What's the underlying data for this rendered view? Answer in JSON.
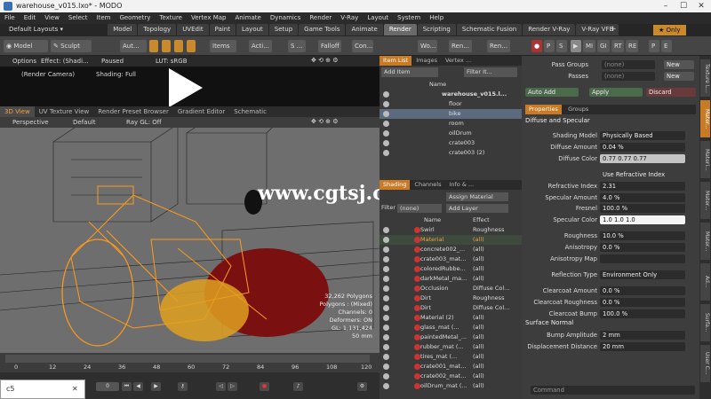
{
  "window": {
    "title": "warehouse_v015.lxo* - MODO",
    "min": "–",
    "max": "☐",
    "close": "✕"
  },
  "menu": [
    "File",
    "Edit",
    "View",
    "Select",
    "Item",
    "Geometry",
    "Texture",
    "Vertex Map",
    "Animate",
    "Dynamics",
    "Render",
    "V-Ray",
    "Layout",
    "System",
    "Help"
  ],
  "layout": {
    "default": "Default Layouts ▾",
    "tabs": [
      "Model",
      "Topology",
      "UVEdit",
      "Paint",
      "Layout",
      "Setup",
      "Game Tools",
      "Animate",
      "Render",
      "Scripting",
      "Schematic Fusion",
      "Render V-Ray",
      "V-Ray VFB"
    ],
    "active_tab": "Render",
    "plus": "+",
    "only": "★ Only"
  },
  "toolbar": {
    "model": "Model",
    "sculpt": "Sculpt",
    "aut": "Aut...",
    "items": "Items",
    "acti": "Acti...",
    "s": "S ...",
    "falloff": "Falloff",
    "con": "Con...",
    "wo": "Wo...",
    "ren1": "Ren...",
    "ren2": "Ren...",
    "btns": [
      "P",
      "S"
    ],
    "render_btns": [
      "MI",
      "GI",
      "RT",
      "RE",
      "P",
      "E"
    ]
  },
  "render_view": {
    "options": "Options",
    "effect": "Effect: (Shadi...",
    "paused": "Paused",
    "lut": "LUT: sRGB",
    "camera": "(Render Camera)",
    "shading": "Shading: Full"
  },
  "viewport": {
    "tabs": [
      "3D View",
      "UV Texture View",
      "Render Preset Browser",
      "Gradient Editor",
      "Schematic"
    ],
    "active": "3D View",
    "perspective": "Perspective",
    "default": "Default",
    "raygl": "Ray GL: Off",
    "stats": [
      "32,262 Polygons",
      "Polygons : (Mixed)",
      "Channels: 0",
      "Deformers: ON",
      "GL: 1,131,424",
      "50 mm"
    ]
  },
  "timeline": {
    "ticks": [
      "0",
      "12",
      "24",
      "36",
      "48",
      "60",
      "72",
      "84",
      "96",
      "108",
      "120"
    ],
    "sub": [
      "0",
      "",
      "",
      "",
      "",
      "",
      "",
      "",
      "",
      "",
      "120"
    ],
    "frame": "0"
  },
  "taskbar": {
    "label": "c5",
    "close": "✕"
  },
  "itemlist": {
    "tabs": [
      "Item List",
      "Images",
      "Vertex ..."
    ],
    "add_item": "Add Item",
    "filter": "Filter It...",
    "header": "Name",
    "items": [
      {
        "name": "warehouse_v015.l...",
        "indent": 0
      },
      {
        "name": "floor",
        "indent": 1
      },
      {
        "name": "bike",
        "indent": 1,
        "selected": true
      },
      {
        "name": "room",
        "indent": 1
      },
      {
        "name": "oilDrum",
        "indent": 1
      },
      {
        "name": "crate003",
        "indent": 1
      },
      {
        "name": "crate003 (2)",
        "indent": 1
      }
    ]
  },
  "shading": {
    "tabs": [
      "Shading",
      "Channels",
      "Info & ..."
    ],
    "assign": "Assign Material",
    "filter_label": "Filter",
    "filter": "(none)",
    "add_layer": "Add Layer",
    "col_name": "Name",
    "col_effect": "Effect",
    "rows": [
      {
        "name": "Swirl",
        "effect": "Roughness"
      },
      {
        "name": "Material",
        "effect": "(all)",
        "hl": true
      },
      {
        "name": "concrete002_...",
        "effect": "(all)"
      },
      {
        "name": "crate003_mat...",
        "effect": "(all)"
      },
      {
        "name": "coloredRubbe...",
        "effect": "(all)"
      },
      {
        "name": "darkMetal_ma...",
        "effect": "(all)"
      },
      {
        "name": "Occlusion",
        "effect": "Diffuse Col..."
      },
      {
        "name": "Dirt",
        "effect": "Roughness"
      },
      {
        "name": "Dirt",
        "effect": "Diffuse Col..."
      },
      {
        "name": "Material (2)",
        "effect": "(all)"
      },
      {
        "name": "glass_mat (...",
        "effect": "(all)"
      },
      {
        "name": "paintedMetal_...",
        "effect": "(all)"
      },
      {
        "name": "rubber_mat (...",
        "effect": "(all)"
      },
      {
        "name": "tires_mat (...",
        "effect": "(all)"
      },
      {
        "name": "crate001_mat...",
        "effect": "(all)"
      },
      {
        "name": "crate002_mat...",
        "effect": "(all)"
      },
      {
        "name": "oilDrum_mat (...",
        "effect": "(all)"
      }
    ]
  },
  "props": {
    "pass_groups": "Pass Groups",
    "passes": "Passes",
    "none": "(none)",
    "new": "New",
    "auto_add": "Auto Add",
    "apply": "Apply",
    "discard": "Discard",
    "tabs": [
      "Properties",
      "Groups"
    ],
    "section1": "Diffuse and Specular",
    "fields": [
      {
        "label": "Shading Model",
        "value": "Physically Based"
      },
      {
        "label": "Diffuse Amount",
        "value": "0.04 %"
      },
      {
        "label": "Diffuse Color",
        "value": "0.77     0.77     0.77"
      },
      {
        "label": "",
        "value": "Use Refractive Index"
      },
      {
        "label": "Refractive Index",
        "value": "2.31"
      },
      {
        "label": "Specular Amount",
        "value": "4.0 %"
      },
      {
        "label": "Fresnel",
        "value": "100.0 %"
      },
      {
        "label": "Specular Color",
        "value": "1.0      1.0      1.0"
      },
      {
        "label": "Roughness",
        "value": "10.0 %"
      },
      {
        "label": "Anisotropy",
        "value": "0.0 %"
      },
      {
        "label": "Anisotropy Map",
        "value": ""
      },
      {
        "label": "Reflection Type",
        "value": "Environment Only"
      },
      {
        "label": "Clearcoat Amount",
        "value": "0.0 %"
      },
      {
        "label": "Clearcoat Roughness",
        "value": "0.0 %"
      },
      {
        "label": "Clearcoat Bump",
        "value": "100.0 %"
      }
    ],
    "section2": "Surface Normal",
    "fields2": [
      {
        "label": "Bump Amplitude",
        "value": "2 mm"
      },
      {
        "label": "Displacement Distance",
        "value": "20 mm"
      }
    ],
    "command": "Command"
  },
  "sidetabs": [
    "Texture L...",
    "Mater...",
    "Materi...",
    "Mater...",
    "Mater...",
    "Ad...",
    "Surfa...",
    "User C..."
  ],
  "watermark": "www.cgtsj.com"
}
